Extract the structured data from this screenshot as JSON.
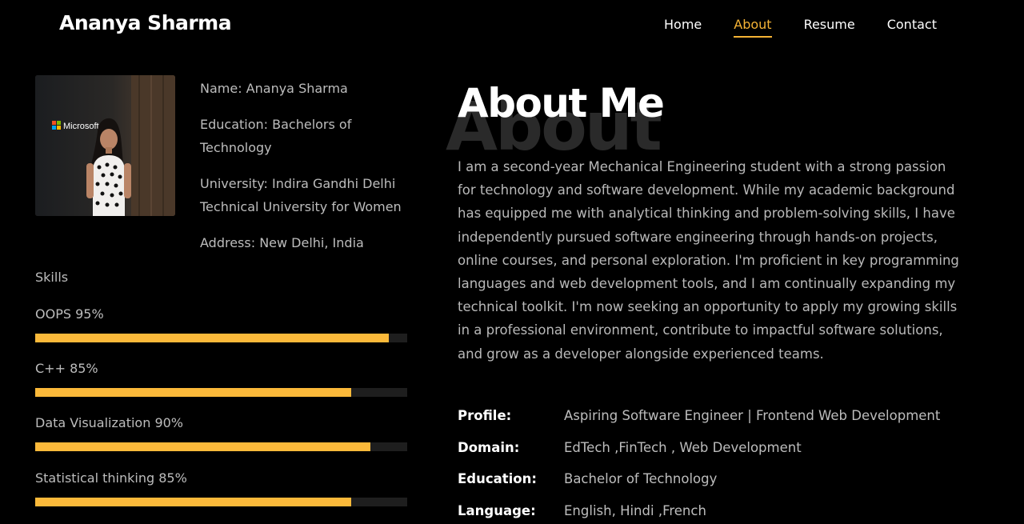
{
  "header": {
    "brand": "Ananya Sharma",
    "nav": [
      {
        "label": "Home",
        "active": false
      },
      {
        "label": "About",
        "active": true
      },
      {
        "label": "Resume",
        "active": false
      },
      {
        "label": "Contact",
        "active": false
      }
    ],
    "accent_color": "#f5b335"
  },
  "profile_photo": {
    "alt": "Ananya Sharma",
    "logo_text": "Microsoft"
  },
  "info": {
    "name": "Name: Ananya Sharma",
    "education": "Education: Bachelors of Technology",
    "university": "University: Indira Gandhi Delhi Technical University for Women",
    "address": "Address: New Delhi, India"
  },
  "skills": {
    "title": "Skills",
    "items": [
      {
        "label": "OOPS 95%",
        "percent": 95
      },
      {
        "label": "C++ 85%",
        "percent": 85
      },
      {
        "label": "Data Visualization 90%",
        "percent": 90
      },
      {
        "label": "Statistical thinking 85%",
        "percent": 85
      }
    ],
    "bar_color": "#fbb93a"
  },
  "about": {
    "watermark": "About",
    "title": "About Me",
    "bio": "I am a second-year Mechanical Engineering student with a strong passion for technology and software development. While my academic background has equipped me with analytical thinking and problem-solving skills, I have independently pursued software engineering through hands-on projects, online courses, and personal exploration. I'm proficient in key programming languages and web development tools, and I am continually expanding my technical toolkit. I'm now seeking an opportunity to apply my growing skills in a professional environment, contribute to impactful software solutions, and grow as a developer alongside experienced teams."
  },
  "facts": [
    {
      "key": "Profile:",
      "value": "Aspiring Software Engineer | Frontend Web Development"
    },
    {
      "key": "Domain:",
      "value": "EdTech ,FinTech , Web Development"
    },
    {
      "key": "Education:",
      "value": "Bachelor of Technology"
    },
    {
      "key": "Language:",
      "value": "English, Hindi ,French"
    }
  ]
}
